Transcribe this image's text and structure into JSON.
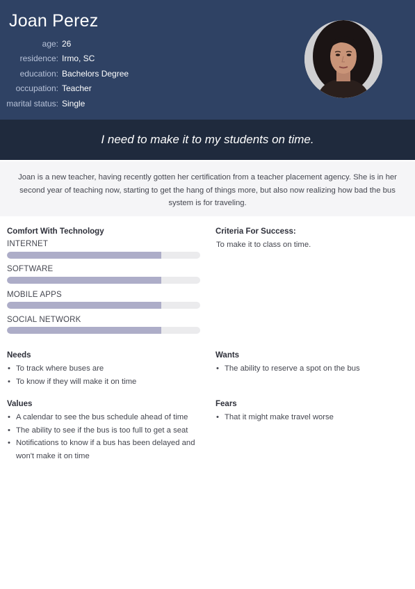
{
  "persona": {
    "name": "Joan Perez",
    "details": [
      {
        "label": "age:",
        "value": "26"
      },
      {
        "label": "residence:",
        "value": "Irmo, SC"
      },
      {
        "label": "education:",
        "value": "Bachelors Degree"
      },
      {
        "label": "occupation:",
        "value": "Teacher"
      },
      {
        "label": "marital status:",
        "value": "Single"
      }
    ],
    "avatar_icon": "user-photo-icon"
  },
  "quote": "I need to make it to my students on time.",
  "bio": "Joan is a new teacher, having recently gotten her certification from a teacher placement agency. She is in her second year of teaching now, starting to get the hang of things more, but also now realizing how bad the bus system is for traveling.",
  "comfort": {
    "title": "Comfort With Technology",
    "skills": [
      {
        "label": "INTERNET",
        "level": 0.8
      },
      {
        "label": "SOFTWARE",
        "level": 0.8
      },
      {
        "label": "MOBILE APPS",
        "level": 0.8
      },
      {
        "label": "SOCIAL NETWORK",
        "level": 0.8
      }
    ]
  },
  "criteria": {
    "title": "Criteria For Success:",
    "text": "To make it to class on time."
  },
  "needs": {
    "title": "Needs",
    "items": [
      "To track where buses are",
      "To know if they will make it on time"
    ]
  },
  "wants": {
    "title": "Wants",
    "items": [
      "The ability to reserve a spot on the bus"
    ]
  },
  "values": {
    "title": "Values",
    "items": [
      "A calendar to see the bus schedule ahead of time",
      "The ability to see if the bus is too full to get a seat",
      "Notifications to know if a bus has been delayed and won't make it on time"
    ]
  },
  "fears": {
    "title": "Fears",
    "items": [
      "That it might make travel worse"
    ]
  },
  "colors": {
    "header": "#2f4264",
    "quote_band": "#1f2a3d",
    "bar_fill": "#adadc8",
    "bar_track": "#ebebed"
  }
}
